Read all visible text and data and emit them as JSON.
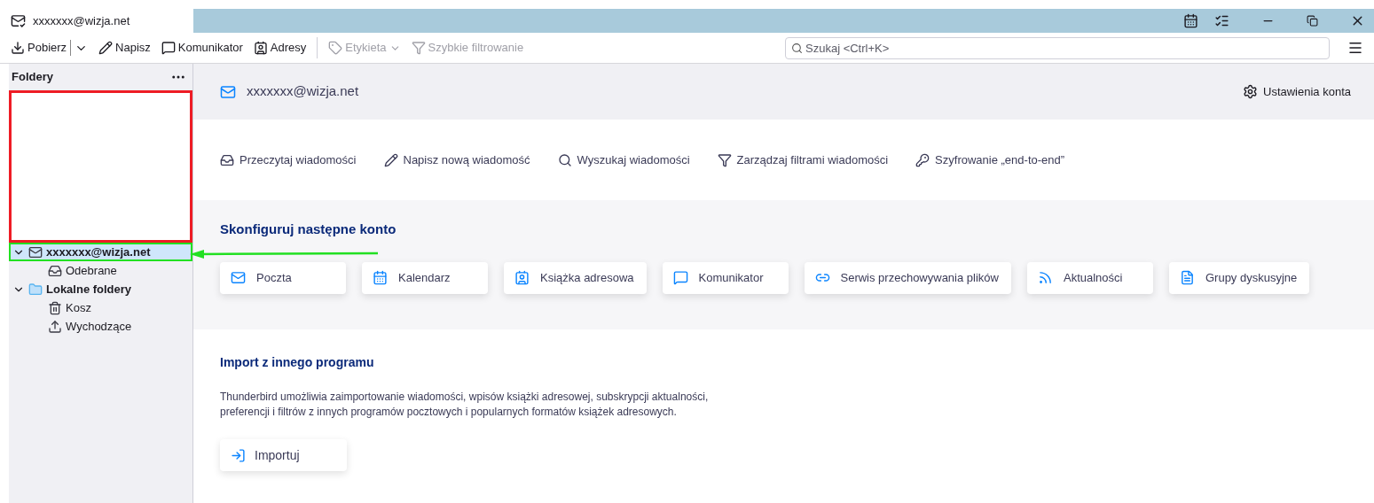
{
  "window": {
    "tab_title": "xxxxxxx@wizja.net"
  },
  "toolbar": {
    "items": [
      {
        "kind": "split",
        "label": "Pobierz",
        "disabled": false
      },
      {
        "kind": "compose",
        "label": "Napisz",
        "disabled": false
      },
      {
        "kind": "chat",
        "label": "Komunikator",
        "disabled": false
      },
      {
        "kind": "contacts",
        "label": "Adresy",
        "disabled": false
      },
      {
        "kind": "tag",
        "label": "Etykieta",
        "disabled": true
      },
      {
        "kind": "filter",
        "label": "Szybkie filtrowanie",
        "disabled": true
      }
    ],
    "search": {
      "placeholder": "Szukaj <Ctrl+K>"
    }
  },
  "sidebar": {
    "title": "Foldery",
    "folders": [
      {
        "kind": "account",
        "name": "xxxxxxx@wizja.net",
        "expanded": true,
        "selected": true,
        "children": [
          {
            "kind": "inbox",
            "name": "Odebrane",
            "selected": false
          }
        ]
      },
      {
        "kind": "folder",
        "name": "Lokalne foldery",
        "expanded": true,
        "selected": false,
        "children": [
          {
            "kind": "trash",
            "name": "Kosz",
            "selected": false
          },
          {
            "kind": "outbox",
            "name": "Wychodzące",
            "selected": false
          }
        ]
      }
    ]
  },
  "account": {
    "title": "xxxxxxx@wizja.net",
    "settings": "Ustawienia konta",
    "actions": [
      {
        "kind": "read",
        "label": "Przeczytaj wiadomości"
      },
      {
        "kind": "compose",
        "label": "Napisz nową wiadomość"
      },
      {
        "kind": "search",
        "label": "Wyszukaj wiadomości"
      },
      {
        "kind": "filter",
        "label": "Zarządzaj filtrami wiadomości"
      },
      {
        "kind": "key",
        "label": "Szyfrowanie „end-to-end”"
      }
    ]
  },
  "setup": {
    "title": "Skonfiguruj następne konto",
    "items": [
      {
        "kind": "mail",
        "label": "Poczta"
      },
      {
        "kind": "calendar",
        "label": "Kalendarz"
      },
      {
        "kind": "contacts",
        "label": "Książka adresowa"
      },
      {
        "kind": "chat",
        "label": "Komunikator"
      },
      {
        "kind": "link",
        "label": "Serwis przechowywania plików"
      },
      {
        "kind": "rss",
        "label": "Aktualności"
      },
      {
        "kind": "news",
        "label": "Grupy dyskusyjne"
      }
    ]
  },
  "import": {
    "title": "Import z innego programu",
    "description": "Thunderbird umożliwia zaimportowanie wiadomości, wpisów książki adresowej, subskrypcji aktualności, preferencji i filtrów z innych programów pocztowych i popularnych formatów książek adresowych.",
    "button": "Importuj"
  }
}
